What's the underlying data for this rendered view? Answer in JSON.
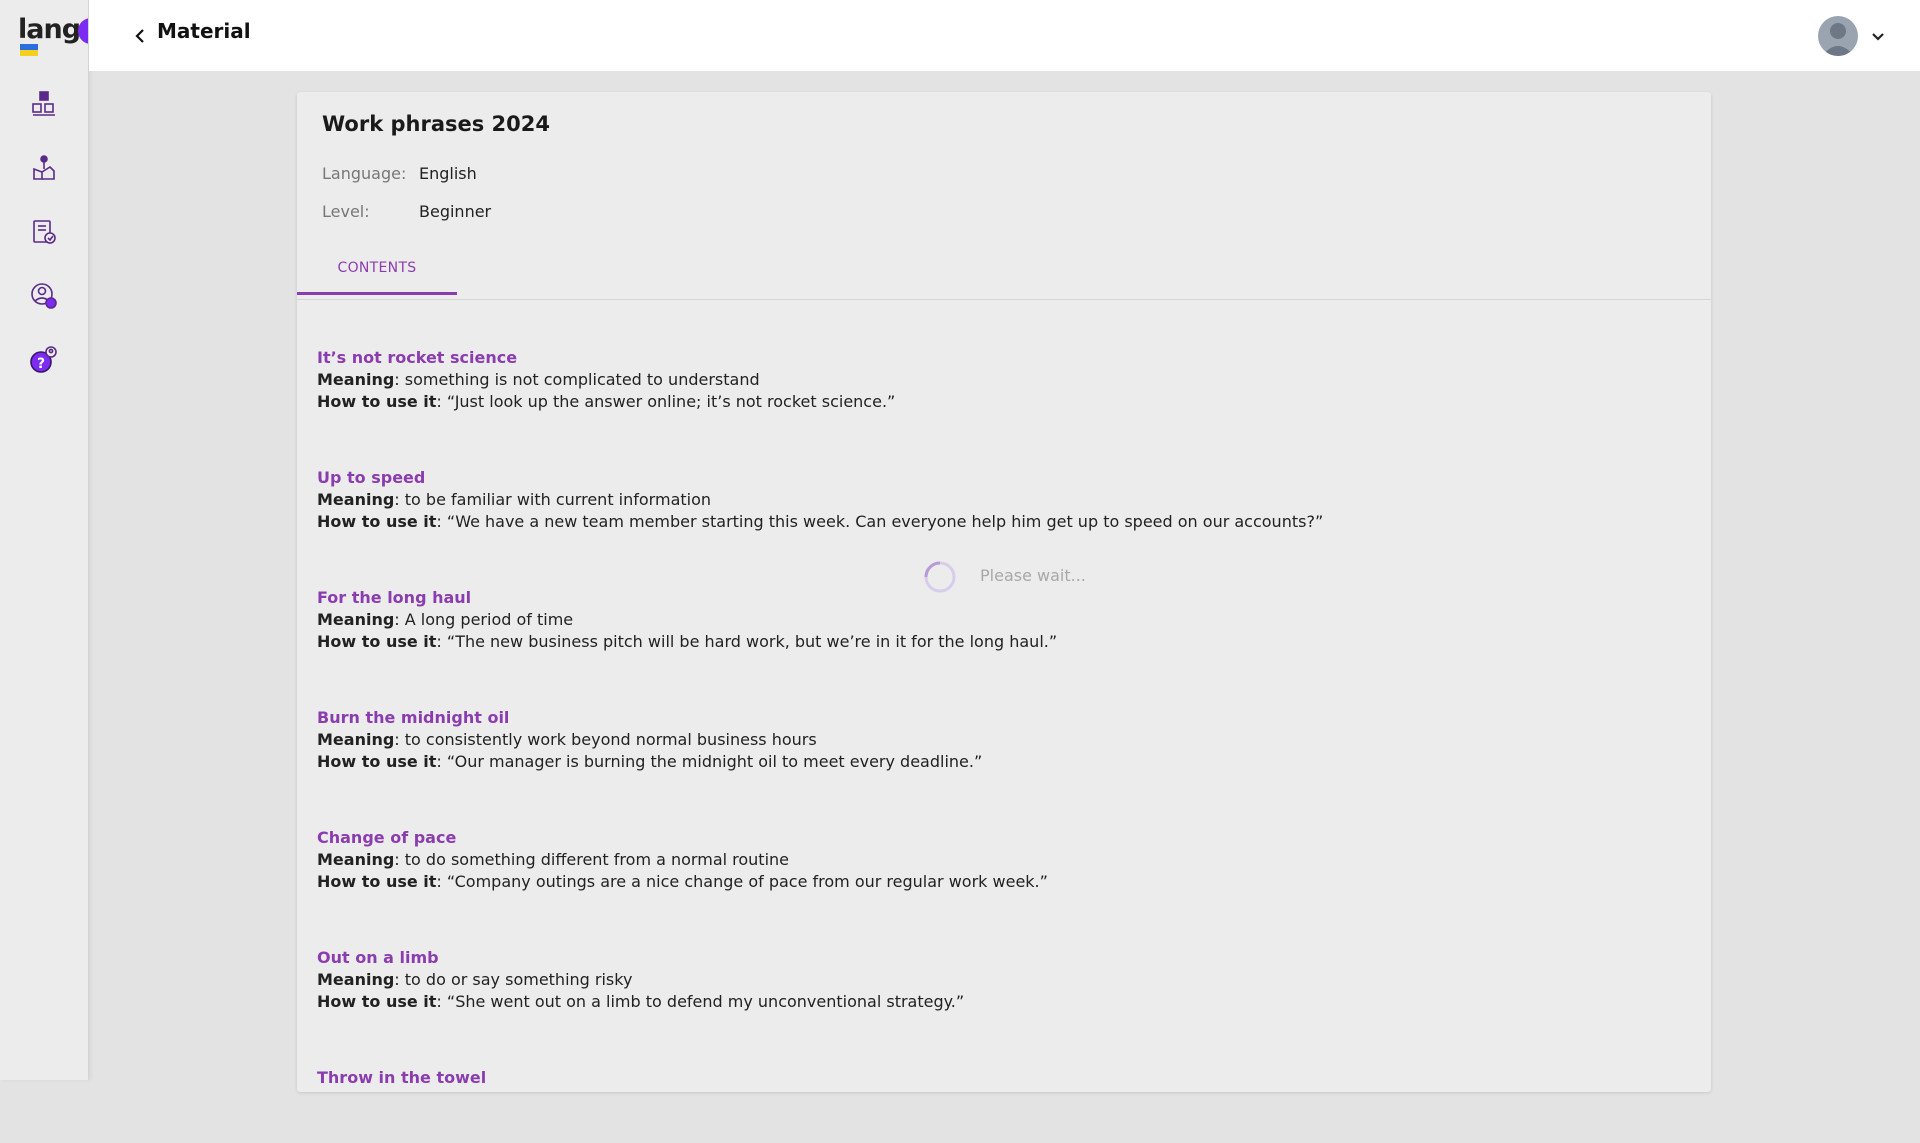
{
  "app": {
    "logo_text": "lang",
    "colors": {
      "accent": "#8b3db0",
      "brand": "#7b2cf0",
      "flag_blue": "#2a6fe0",
      "flag_yellow": "#f4cf1e"
    }
  },
  "sidebar": {
    "items": [
      {
        "name": "blocks-icon"
      },
      {
        "name": "courses-icon"
      },
      {
        "name": "materials-icon"
      },
      {
        "name": "users-icon"
      },
      {
        "name": "help-icon"
      }
    ]
  },
  "header": {
    "title": "Material"
  },
  "material": {
    "title": "Work phrases 2024",
    "language_label": "Language:",
    "language_value": "English",
    "level_label": "Level:",
    "level_value": "Beginner",
    "tab_label": "CONTENTS",
    "meaning_label": "Meaning",
    "usage_label": "How to use it",
    "phrases": [
      {
        "title": "It’s not rocket science",
        "meaning": ": something is not complicated to understand",
        "usage": ": “Just look up the answer online; it’s not rocket science.”"
      },
      {
        "title": "Up to speed",
        "meaning": ": to be familiar with current information",
        "usage": ": “We have a new team member starting this week. Can everyone help him get up to speed on our accounts?”"
      },
      {
        "title": "For the long haul",
        "meaning": ": A long period of time",
        "usage": ": “The new business pitch will be hard work, but we’re in it for the long haul.”"
      },
      {
        "title": "Burn the midnight oil",
        "meaning": ": to consistently work beyond normal business hours",
        "usage": ": “Our manager is burning the midnight oil to meet every deadline.”"
      },
      {
        "title": "Change of pace",
        "meaning": ": to do something different from a normal routine",
        "usage": ": “Company outings are a nice change of pace from our regular work week.”"
      },
      {
        "title": "Out on a limb",
        "meaning": ": to do or say something risky",
        "usage": ": “She went out on a limb to defend my unconventional strategy.”"
      },
      {
        "title": "Throw in the towel",
        "meaning": "",
        "usage": ""
      }
    ]
  },
  "loading": {
    "text": "Please wait..."
  }
}
